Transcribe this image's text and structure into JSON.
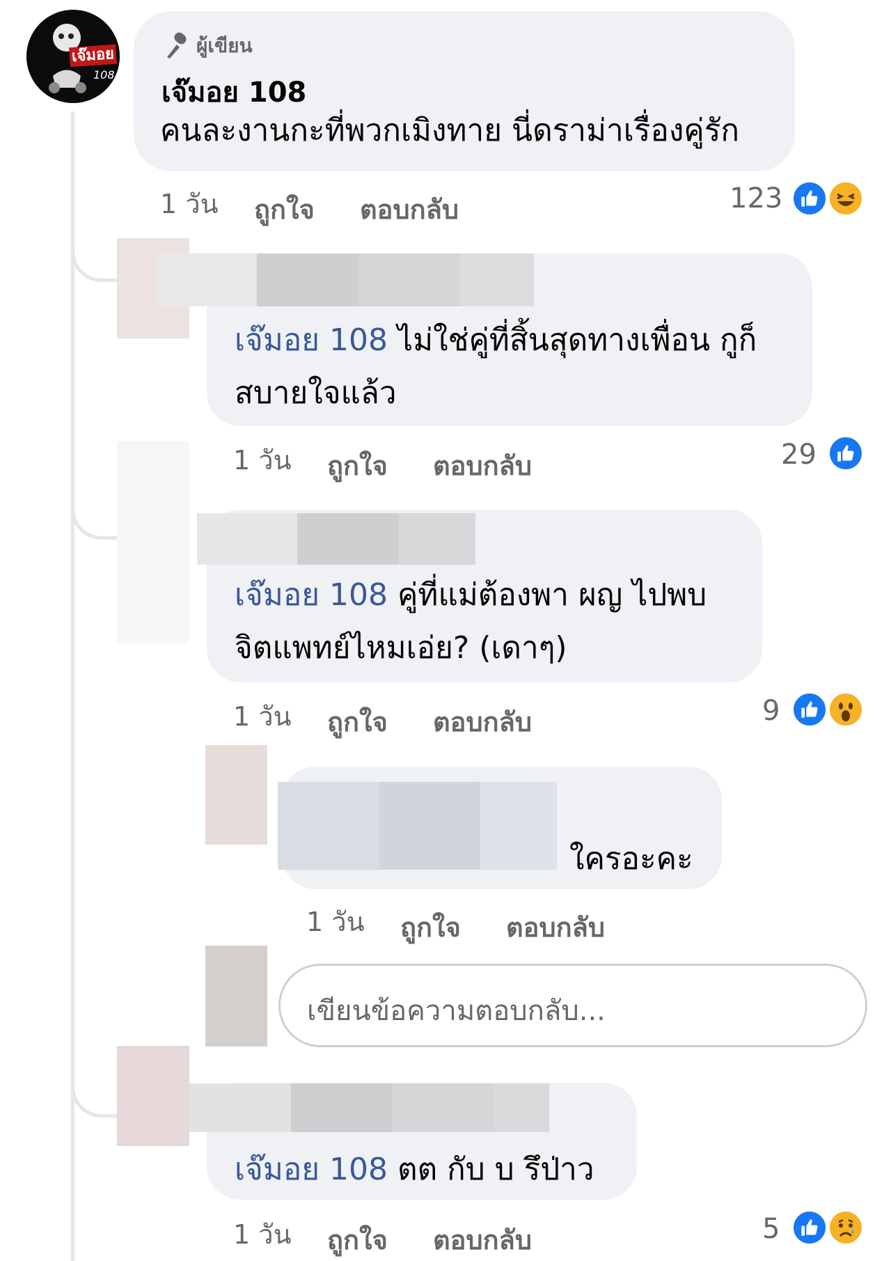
{
  "author_badge": "ผู้เขียน",
  "logo_text": "เจ๊มอย",
  "logo_sub": "108",
  "colors": {
    "mention": "#385898",
    "like": "#1877f2",
    "bubble": "#eff1f4",
    "meta": "#65676b"
  },
  "main_comment": {
    "author": "เจ๊มอย 108",
    "text": "คนละงานกะที่พวกเมิงทาย นี่ดราม่าเรื่องคู่รัก",
    "time": "1 วัน",
    "like_label": "ถูกใจ",
    "reply_label": "ตอบกลับ",
    "reaction_count": "123",
    "reactions": [
      "like-icon",
      "laugh-icon"
    ]
  },
  "replies": [
    {
      "mention": "เจ๊มอย 108",
      "text_line1": "ไม่ใช่คู่ที่สิ้นสุดทางเพื่อน กูก็",
      "text_line2": "สบายใจแล้ว",
      "time": "1 วัน",
      "like_label": "ถูกใจ",
      "reply_label": "ตอบกลับ",
      "reaction_count": "29",
      "reactions": [
        "like-icon"
      ]
    },
    {
      "mention": "เจ๊มอย 108",
      "text_line1": "คู่ที่แม่ต้องพา ผญ ไปพบ",
      "text_line2": "จิตแพทย์ไหมเอ่ย? (เดาๆ)",
      "time": "1 วัน",
      "like_label": "ถูกใจ",
      "reply_label": "ตอบกลับ",
      "reaction_count": "9",
      "reactions": [
        "like-icon",
        "wow-icon"
      ]
    },
    {
      "text": "ใครอะคะ",
      "time": "1 วัน",
      "like_label": "ถูกใจ",
      "reply_label": "ตอบกลับ"
    },
    {
      "mention": "เจ๊มอย 108",
      "text_line1": "ตต กับ บ รึป่าว",
      "time": "1 วัน",
      "like_label": "ถูกใจ",
      "reply_label": "ตอบกลับ",
      "reaction_count": "5",
      "reactions": [
        "like-icon",
        "sad-icon"
      ]
    }
  ],
  "reply_input": {
    "placeholder": "เขียนข้อความตอบกลับ..."
  }
}
